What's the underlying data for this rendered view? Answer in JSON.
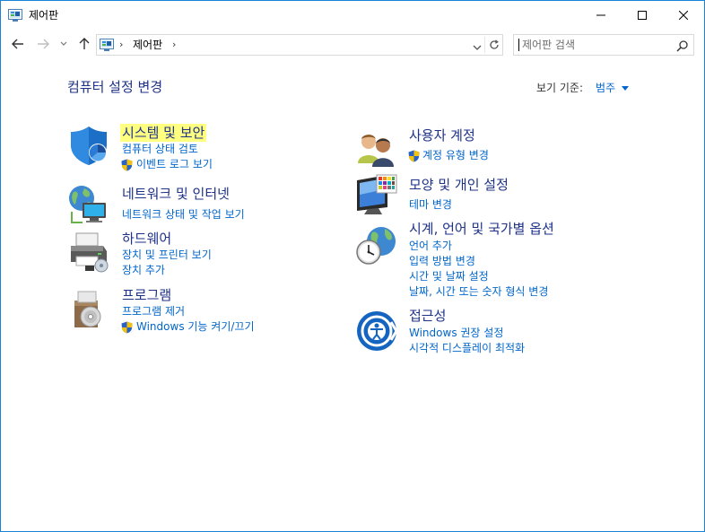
{
  "window": {
    "title": "제어판",
    "accent": "#1883d7"
  },
  "nav": {
    "back_icon": "arrow-left-icon",
    "forward_icon": "arrow-right-icon",
    "recent_icon": "chevron-down-icon",
    "up_icon": "arrow-up-icon"
  },
  "address": {
    "separator": "›",
    "path": "제어판"
  },
  "search": {
    "placeholder": "제어판 검색"
  },
  "header": {
    "title": "컴퓨터 설정 변경",
    "view_by_label": "보기 기준:",
    "view_by_value": "범주"
  },
  "colors": {
    "category_title": "#1e3287",
    "link": "#0066cc",
    "highlight": "#ffff80"
  },
  "categories": [
    {
      "id": "system-security",
      "title": "시스템 및 보안",
      "icon": "shield-security-icon",
      "links": [
        {
          "label": "컴퓨터 상태 검토",
          "shield": false
        },
        {
          "label": "이벤트 로그 보기",
          "shield": true
        }
      ]
    },
    {
      "id": "network",
      "title": "네트워크 및 인터넷",
      "icon": "network-globe-icon",
      "links": [
        {
          "label": "네트워크 상태 및 작업 보기",
          "shield": false
        }
      ]
    },
    {
      "id": "hardware",
      "title": "하드웨어",
      "icon": "printer-hardware-icon",
      "links": [
        {
          "label": "장치 및 프린터 보기",
          "shield": false
        },
        {
          "label": "장치 추가",
          "shield": false
        }
      ]
    },
    {
      "id": "programs",
      "title": "프로그램",
      "icon": "programs-disc-icon",
      "links": [
        {
          "label": "프로그램 제거",
          "shield": false
        },
        {
          "label": "Windows 기능 켜기/끄기",
          "shield": true
        }
      ]
    },
    {
      "id": "user-accounts",
      "title": "사용자 계정",
      "icon": "users-icon",
      "links": [
        {
          "label": "계정 유형 변경",
          "shield": true
        }
      ]
    },
    {
      "id": "appearance",
      "title": "모양 및 개인 설정",
      "icon": "monitor-appearance-icon",
      "links": [
        {
          "label": "테마 변경",
          "shield": false
        }
      ]
    },
    {
      "id": "clock-region",
      "title": "시계, 언어 및 국가별 옵션",
      "icon": "clock-globe-icon",
      "links": [
        {
          "label": "언어 추가",
          "shield": false
        },
        {
          "label": "입력 방법 변경",
          "shield": false
        },
        {
          "label": "시간 및 날짜 설정",
          "shield": false
        },
        {
          "label": "날짜, 시간 또는 숫자 형식 변경",
          "shield": false
        }
      ]
    },
    {
      "id": "ease-of-access",
      "title": "접근성",
      "icon": "ease-of-access-icon",
      "links": [
        {
          "label": "Windows 권장 설정",
          "shield": false
        },
        {
          "label": "시각적 디스플레이 최적화",
          "shield": false
        }
      ]
    }
  ]
}
